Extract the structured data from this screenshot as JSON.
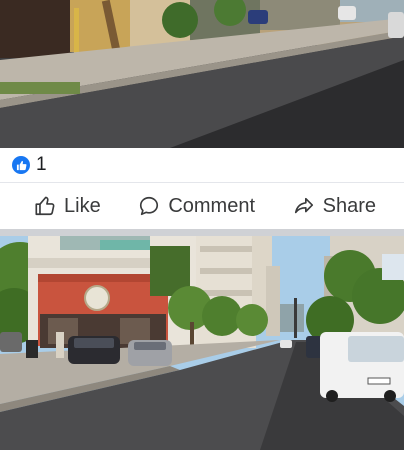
{
  "post": {
    "reaction_count": "1",
    "reaction_icon": "like-icon",
    "accent_color": "#1877f2"
  },
  "actions": {
    "like_label": "Like",
    "comment_label": "Comment",
    "share_label": "Share"
  },
  "photos": [
    {
      "name": "street-photo-top"
    },
    {
      "name": "street-photo-bottom"
    }
  ]
}
